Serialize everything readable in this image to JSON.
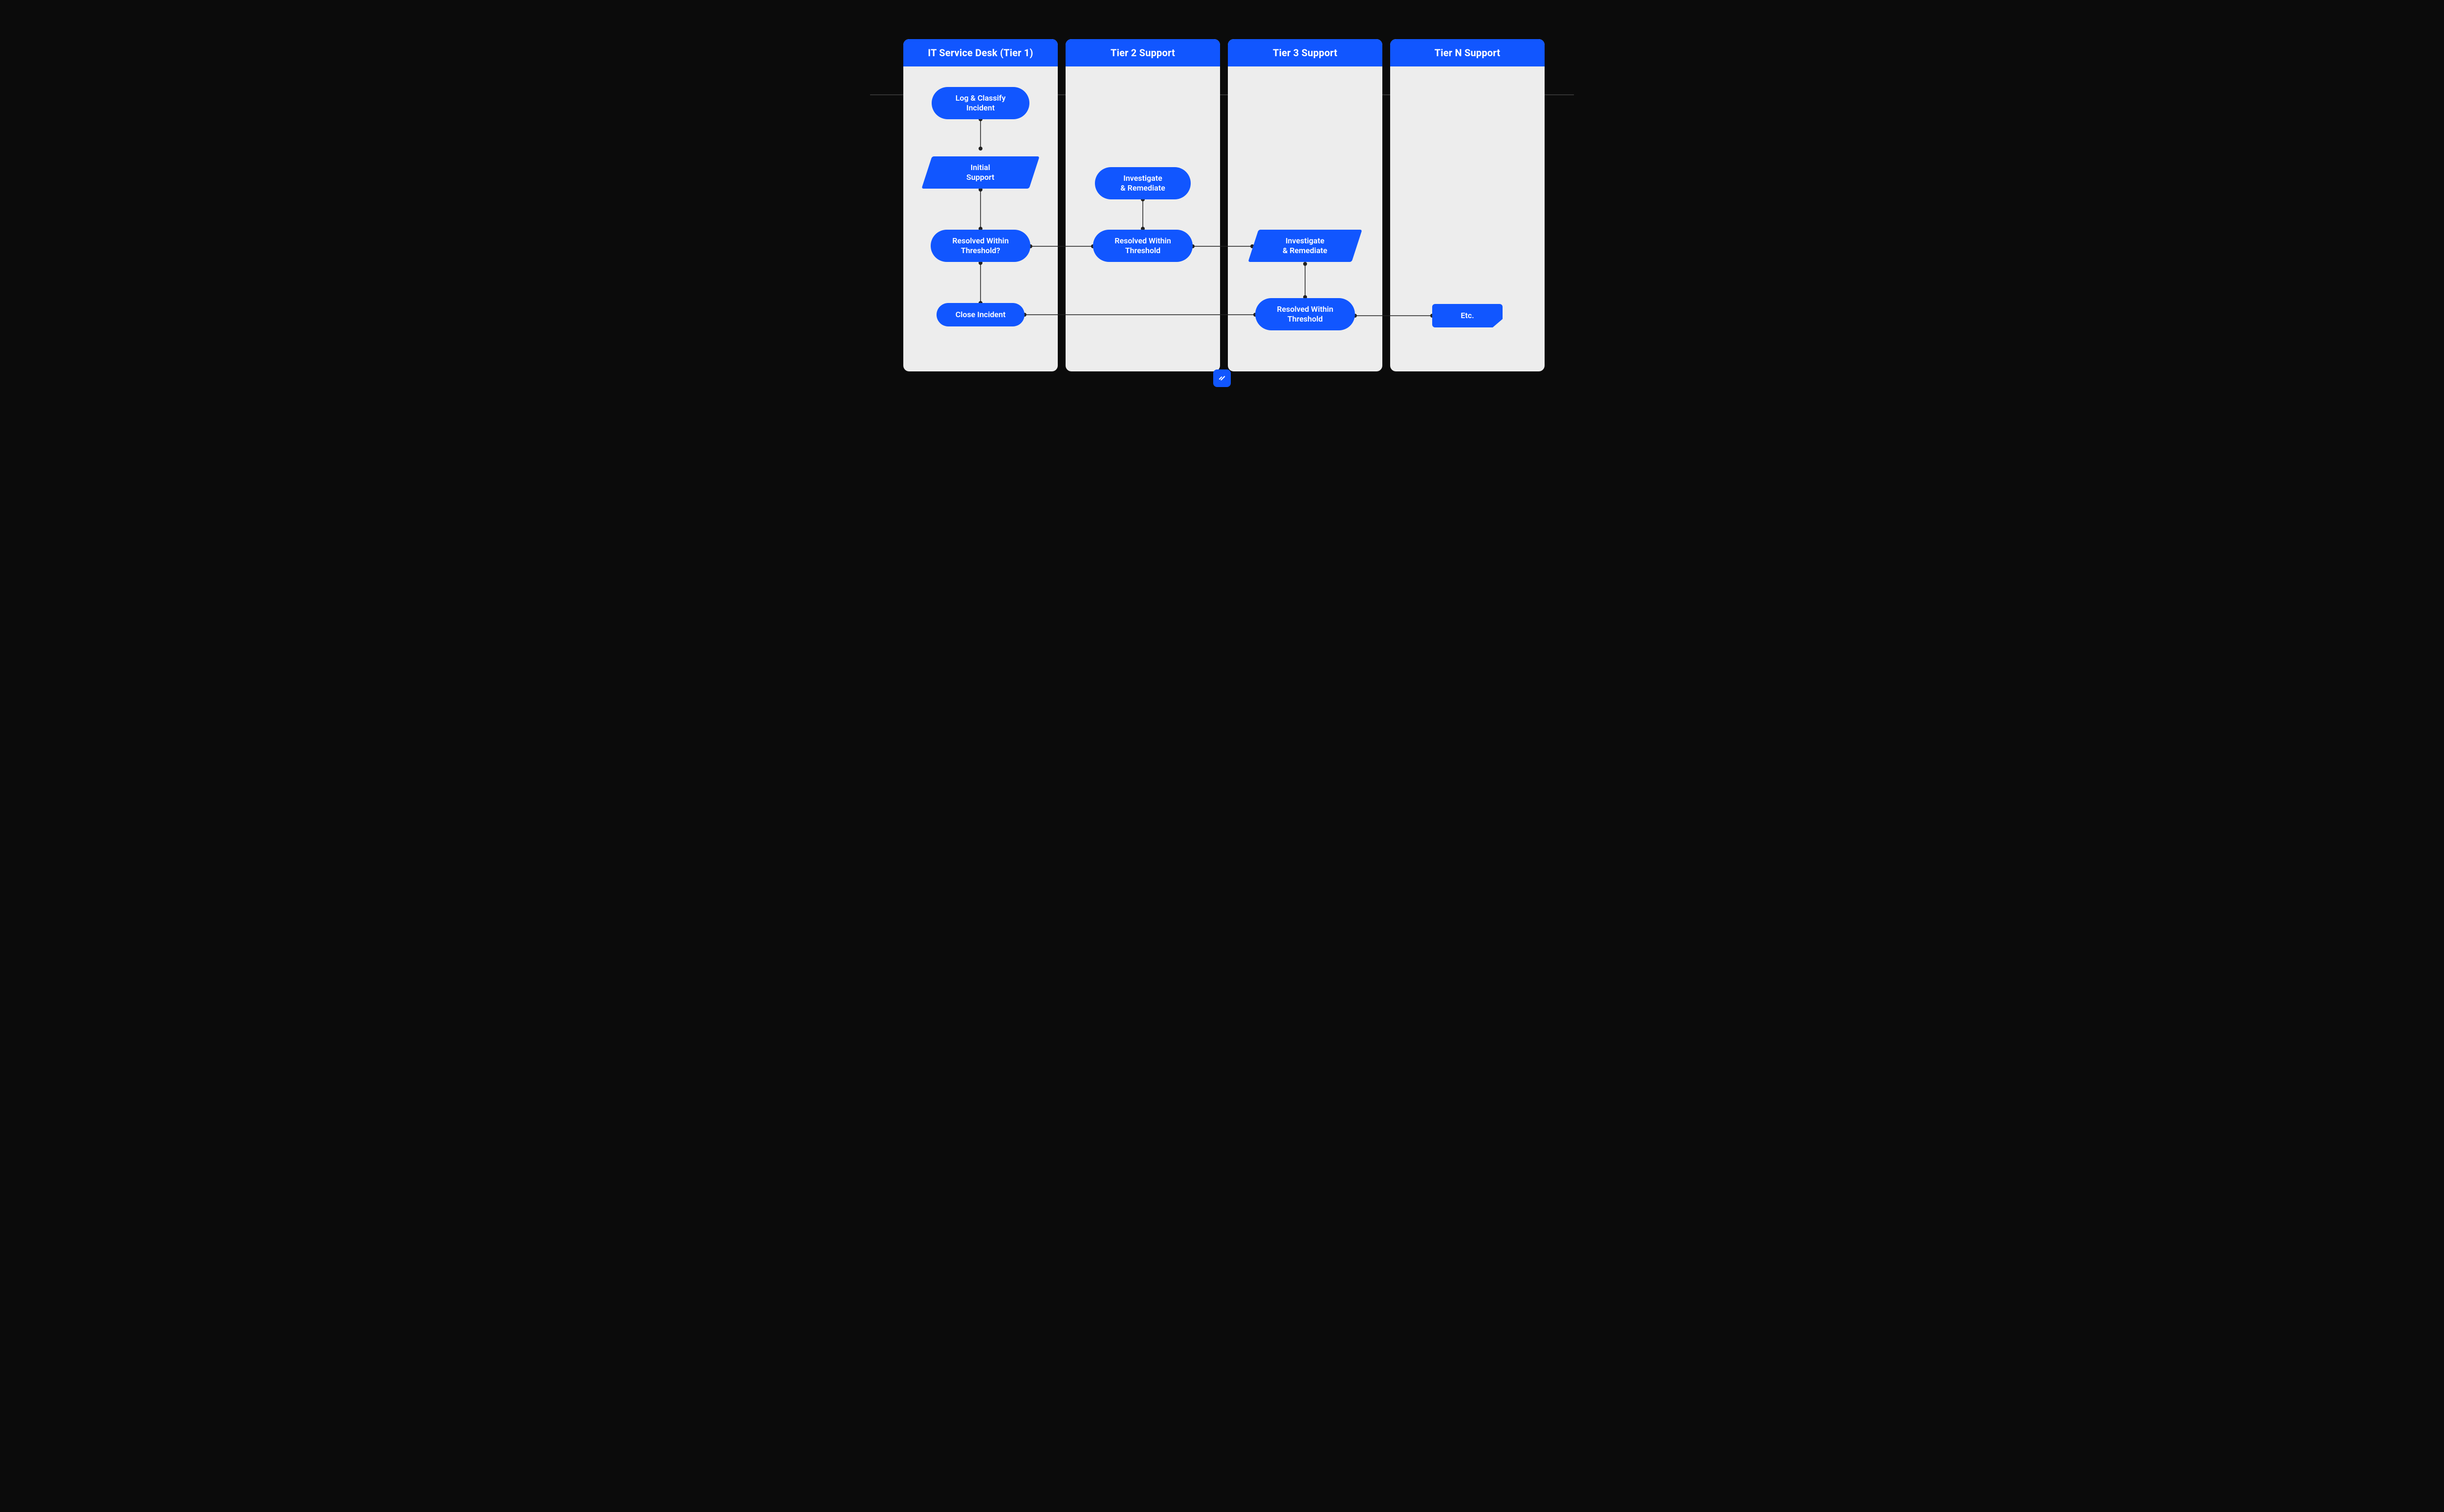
{
  "lanes": [
    {
      "title": "IT Service Desk (Tier 1)"
    },
    {
      "title": "Tier 2 Support"
    },
    {
      "title": "Tier 3 Support"
    },
    {
      "title": "Tier N Support"
    }
  ],
  "nodes": {
    "log": {
      "l1": "Log & Classify",
      "l2": "Incident"
    },
    "initial": {
      "l1": "Initial",
      "l2": "Support"
    },
    "resolved_q": {
      "l1": "Resolved Within",
      "l2": "Threshold?"
    },
    "close": {
      "l1": "Close Incident"
    },
    "t2_invest": {
      "l1": "Investigate",
      "l2": "& Remediate"
    },
    "t2_resolved": {
      "l1": "Resolved Within",
      "l2": "Threshold"
    },
    "t3_invest": {
      "l1": "Investigate",
      "l2": "& Remediate"
    },
    "t3_resolved": {
      "l1": "Resolved Within",
      "l2": "Threshold"
    },
    "etc": {
      "l1": "Etc."
    }
  },
  "colors": {
    "accent": "#1156ff",
    "panel": "#ededed",
    "bg": "#0b0b0b"
  }
}
